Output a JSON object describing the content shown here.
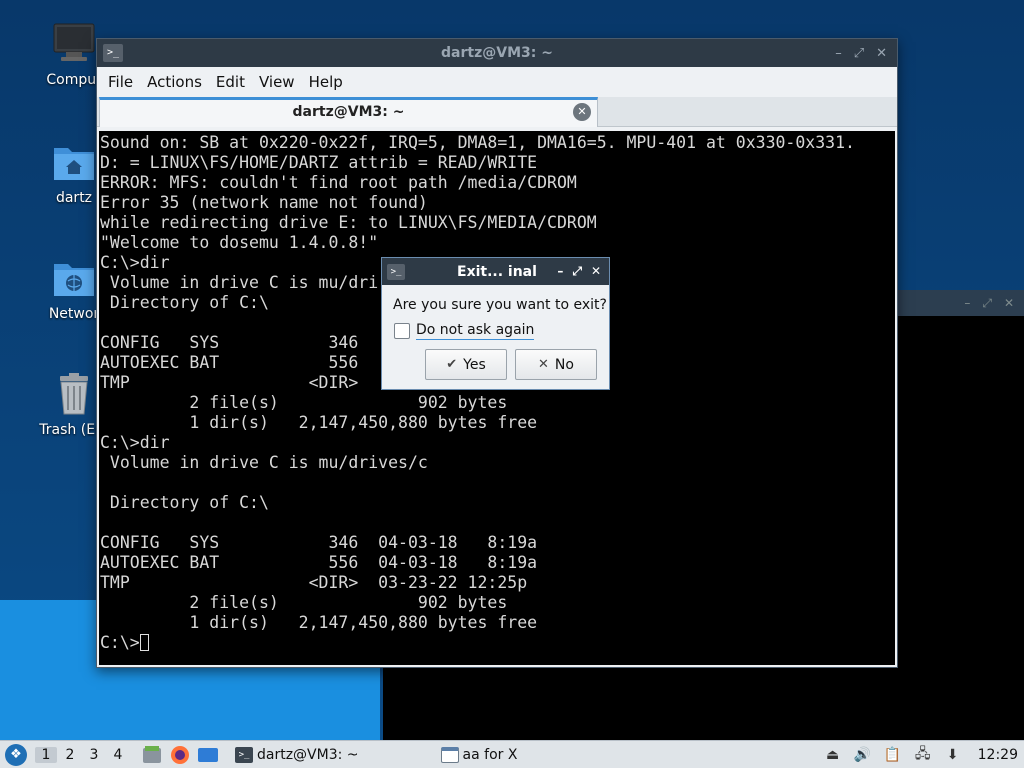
{
  "desktop": {
    "icons": [
      {
        "label": "Comput",
        "icon": "computer-icon"
      },
      {
        "label": "dartz",
        "icon": "home-folder-icon"
      },
      {
        "label": "Networ",
        "icon": "network-folder-icon"
      },
      {
        "label": "Trash (Em",
        "icon": "trash-icon"
      }
    ]
  },
  "terminal": {
    "title": "dartz@VM3: ~",
    "menu": [
      "File",
      "Actions",
      "Edit",
      "View",
      "Help"
    ],
    "tab_title": "dartz@VM3: ~",
    "lines": [
      "Sound on: SB at 0x220-0x22f, IRQ=5, DMA8=1, DMA16=5. MPU-401 at 0x330-0x331.",
      "D: = LINUX\\FS/HOME/DARTZ attrib = READ/WRITE",
      "ERROR: MFS: couldn't find root path /media/CDROM",
      "Error 35 (network name not found)",
      "while redirecting drive E: to LINUX\\FS/MEDIA/CDROM",
      "\"Welcome to dosemu 1.4.0.8!\"",
      "C:\\>dir",
      " Volume in drive C is mu/dri",
      " Directory of C:\\",
      "",
      "CONFIG   SYS           346  ",
      "AUTOEXEC BAT           556  ",
      "TMP                  <DIR>  ",
      "         2 file(s)              902 bytes",
      "         1 dir(s)   2,147,450,880 bytes free",
      "C:\\>dir",
      " Volume in drive C is mu/drives/c",
      "",
      " Directory of C:\\",
      "",
      "CONFIG   SYS           346  04-03-18   8:19a",
      "AUTOEXEC BAT           556  04-03-18   8:19a",
      "TMP                  <DIR>  03-23-22 12:25p",
      "         2 file(s)              902 bytes",
      "         1 dir(s)   2,147,450,880 bytes free"
    ],
    "prompt": "C:\\>"
  },
  "dialog": {
    "title": "Exit... inal",
    "message": "Are you sure you want to exit?",
    "checkbox_label": "Do not ask again",
    "checkbox_checked": false,
    "yes_label": "Yes",
    "no_label": "No"
  },
  "taskbar": {
    "workspaces": [
      "1",
      "2",
      "3",
      "4"
    ],
    "active_workspace": "1",
    "tasks": [
      {
        "label": "dartz@VM3: ~"
      },
      {
        "label": "aa for X"
      }
    ],
    "clock": "12:29"
  }
}
